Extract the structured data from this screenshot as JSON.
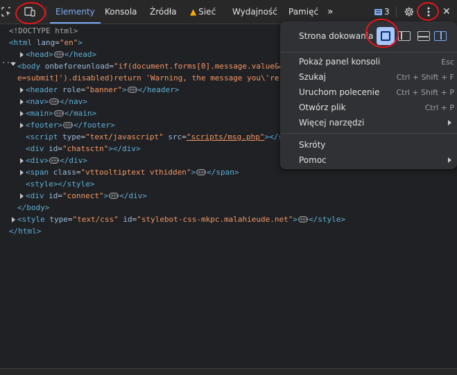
{
  "toolbar": {
    "tabs": [
      "Elementy",
      "Konsola",
      "Źródła",
      "Sieć",
      "Wydajność",
      "Pamięć"
    ],
    "more_tabs": "»",
    "issues_count": "3",
    "close": "✕"
  },
  "code": {
    "doctype": "<!DOCTYPE html>",
    "html_open": "<html",
    "lang_attr": "lang",
    "lang_val": "\"en\"",
    "head": "<head>",
    "head_close": "</head>",
    "body_tag": "<body",
    "body_attr": "onbeforeunload",
    "body_val_1": "\"if(document.forms[0].message.value&&",
    "body_val_2": "e=submit]').disabled)return 'Warning, the message you\\'re",
    "header_open": "<header",
    "header_attr": "role",
    "header_val": "\"banner\"",
    "header_close": "</header>",
    "nav_open": "<nav>",
    "nav_close": "</nav>",
    "main_open": "<main>",
    "main_close": "</main>",
    "footer_open": "<footer>",
    "footer_close": "</footer>",
    "script_open": "<script",
    "script_type_attr": "type",
    "script_type_val": "\"text/javascript\"",
    "script_src_attr": "src",
    "script_src_val": "\"scripts/msg.php\"",
    "script_close": "></s",
    "div_chat_open": "<div",
    "div_id_attr": "id",
    "div_chat_val": "\"chatsctn\"",
    "div_chat_close": "></div>",
    "div_open": "<div>",
    "div_close": "</div>",
    "span_open": "<span",
    "span_class_attr": "class",
    "span_class_val": "\"vttooltiptext vthidden\"",
    "span_end": ">",
    "span_close": "</span>",
    "style_open": "<style>",
    "style_close": "</style>",
    "div_connect_val": "\"connect\"",
    "body_close": "</body>",
    "style2_open": "<style",
    "style2_type_val": "\"text/css\"",
    "style2_id_val": "\"stylebot-css-mkpc.malahieude.net\"",
    "gt": ">",
    "html_close": "</html>"
  },
  "menu": {
    "dock_label": "Strona dokowania",
    "items": [
      {
        "label": "Pokaż panel konsoli",
        "shortcut": "Esc"
      },
      {
        "label": "Szukaj",
        "shortcut": "Ctrl + Shift + F"
      },
      {
        "label": "Uruchom polecenie",
        "shortcut": "Ctrl + Shift + P"
      },
      {
        "label": "Otwórz plik",
        "shortcut": "Ctrl + P"
      },
      {
        "label": "Więcej narzędzi",
        "shortcut": ""
      }
    ],
    "items2": [
      {
        "label": "Skróty"
      },
      {
        "label": "Pomoc"
      }
    ]
  },
  "colors": {
    "accent": "#7cacf8",
    "annotation": "#e8141a",
    "warning": "#f9ab00"
  }
}
